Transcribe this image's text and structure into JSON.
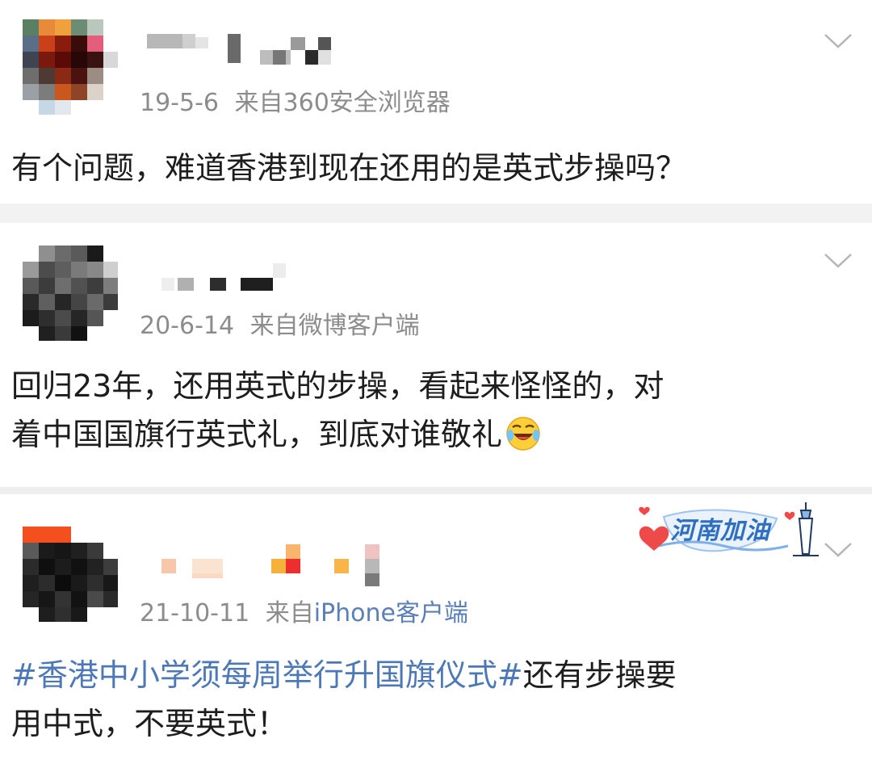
{
  "comments": [
    {
      "date": "19-5-6",
      "source_prefix": "来自",
      "source": "360安全浏览器",
      "text": "有个问题，难道香港到现在还用的是英式步操吗？"
    },
    {
      "date": "20-6-14",
      "source_prefix": "来自",
      "source": "微博客户端",
      "text_line1": "回归23年，还用英式的步操，看起来怪怪的，对",
      "text_line2": "着中国国旗行英式礼，到底对谁敬礼",
      "emoji": "laugh-cry-emoji"
    },
    {
      "date": "21-10-11",
      "source_prefix": "来自",
      "source": "iPhone客户端",
      "badge": "河南加油",
      "topic": "#香港中小学须每周举行升国旗仪式#",
      "text_after_topic": "还有步操要",
      "text_line2": "用中式，不要英式！"
    }
  ],
  "colors": {
    "meta_gray": "#8c8c8c",
    "link_blue": "#4d78b8",
    "divider": "#f2f2f2"
  },
  "icons": [
    "chevron-down-icon",
    "laugh-cry-emoji",
    "heart-icon",
    "tower-icon"
  ]
}
